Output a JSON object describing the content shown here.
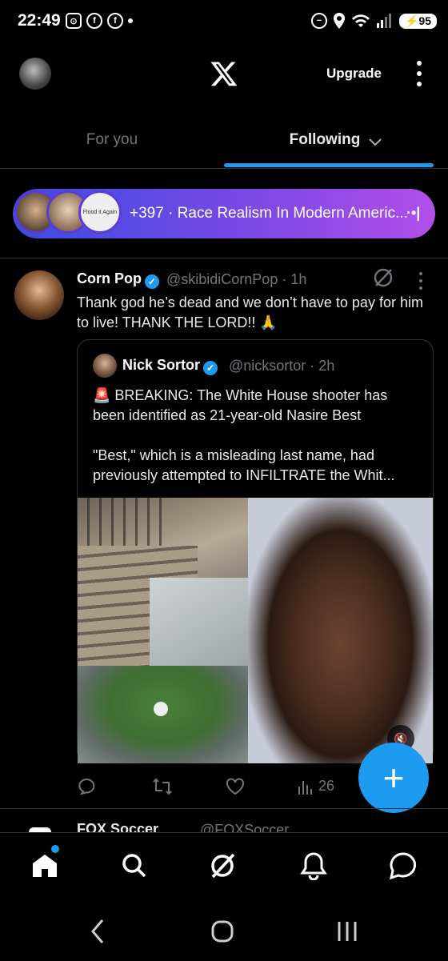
{
  "status_bar": {
    "time": "22:49",
    "battery": "95",
    "network": "6"
  },
  "header": {
    "upgrade_label": "Upgrade",
    "logo": "x-logo"
  },
  "tabs": [
    {
      "label": "For you",
      "active": false
    },
    {
      "label": "Following",
      "active": true
    }
  ],
  "community": {
    "text": "+397 · Race Realism In Modern Americ...",
    "avatar3_text": "Flood it Again"
  },
  "tweet": {
    "name": "Corn Pop",
    "handle": "@skibidiCornPop · 1h",
    "text": "Thank god he’s dead and we don’t have to pay for him to live! THANK THE LORD!! 🙏",
    "quote": {
      "name": "Nick Sortor",
      "handle": "@nicksortor · 2h",
      "text_line1": "🚨 BREAKING: The White House shooter has been identified as 21-year-old Nasire Best",
      "text_line2": "\"Best,\" which is a misleading last name, had previously attempted to INFILTRATE the Whit..."
    },
    "actions": {
      "reply": "",
      "retweet": "",
      "like": "",
      "views": "26"
    }
  },
  "next_tweet": {
    "name": "FOX Soccer",
    "handle": "@FOXSoccer"
  },
  "fab_label": "+",
  "accent_color": "#1d9bf0",
  "icons": [
    "home-icon",
    "search-icon",
    "grok-icon",
    "notifications-icon",
    "messages-icon"
  ]
}
